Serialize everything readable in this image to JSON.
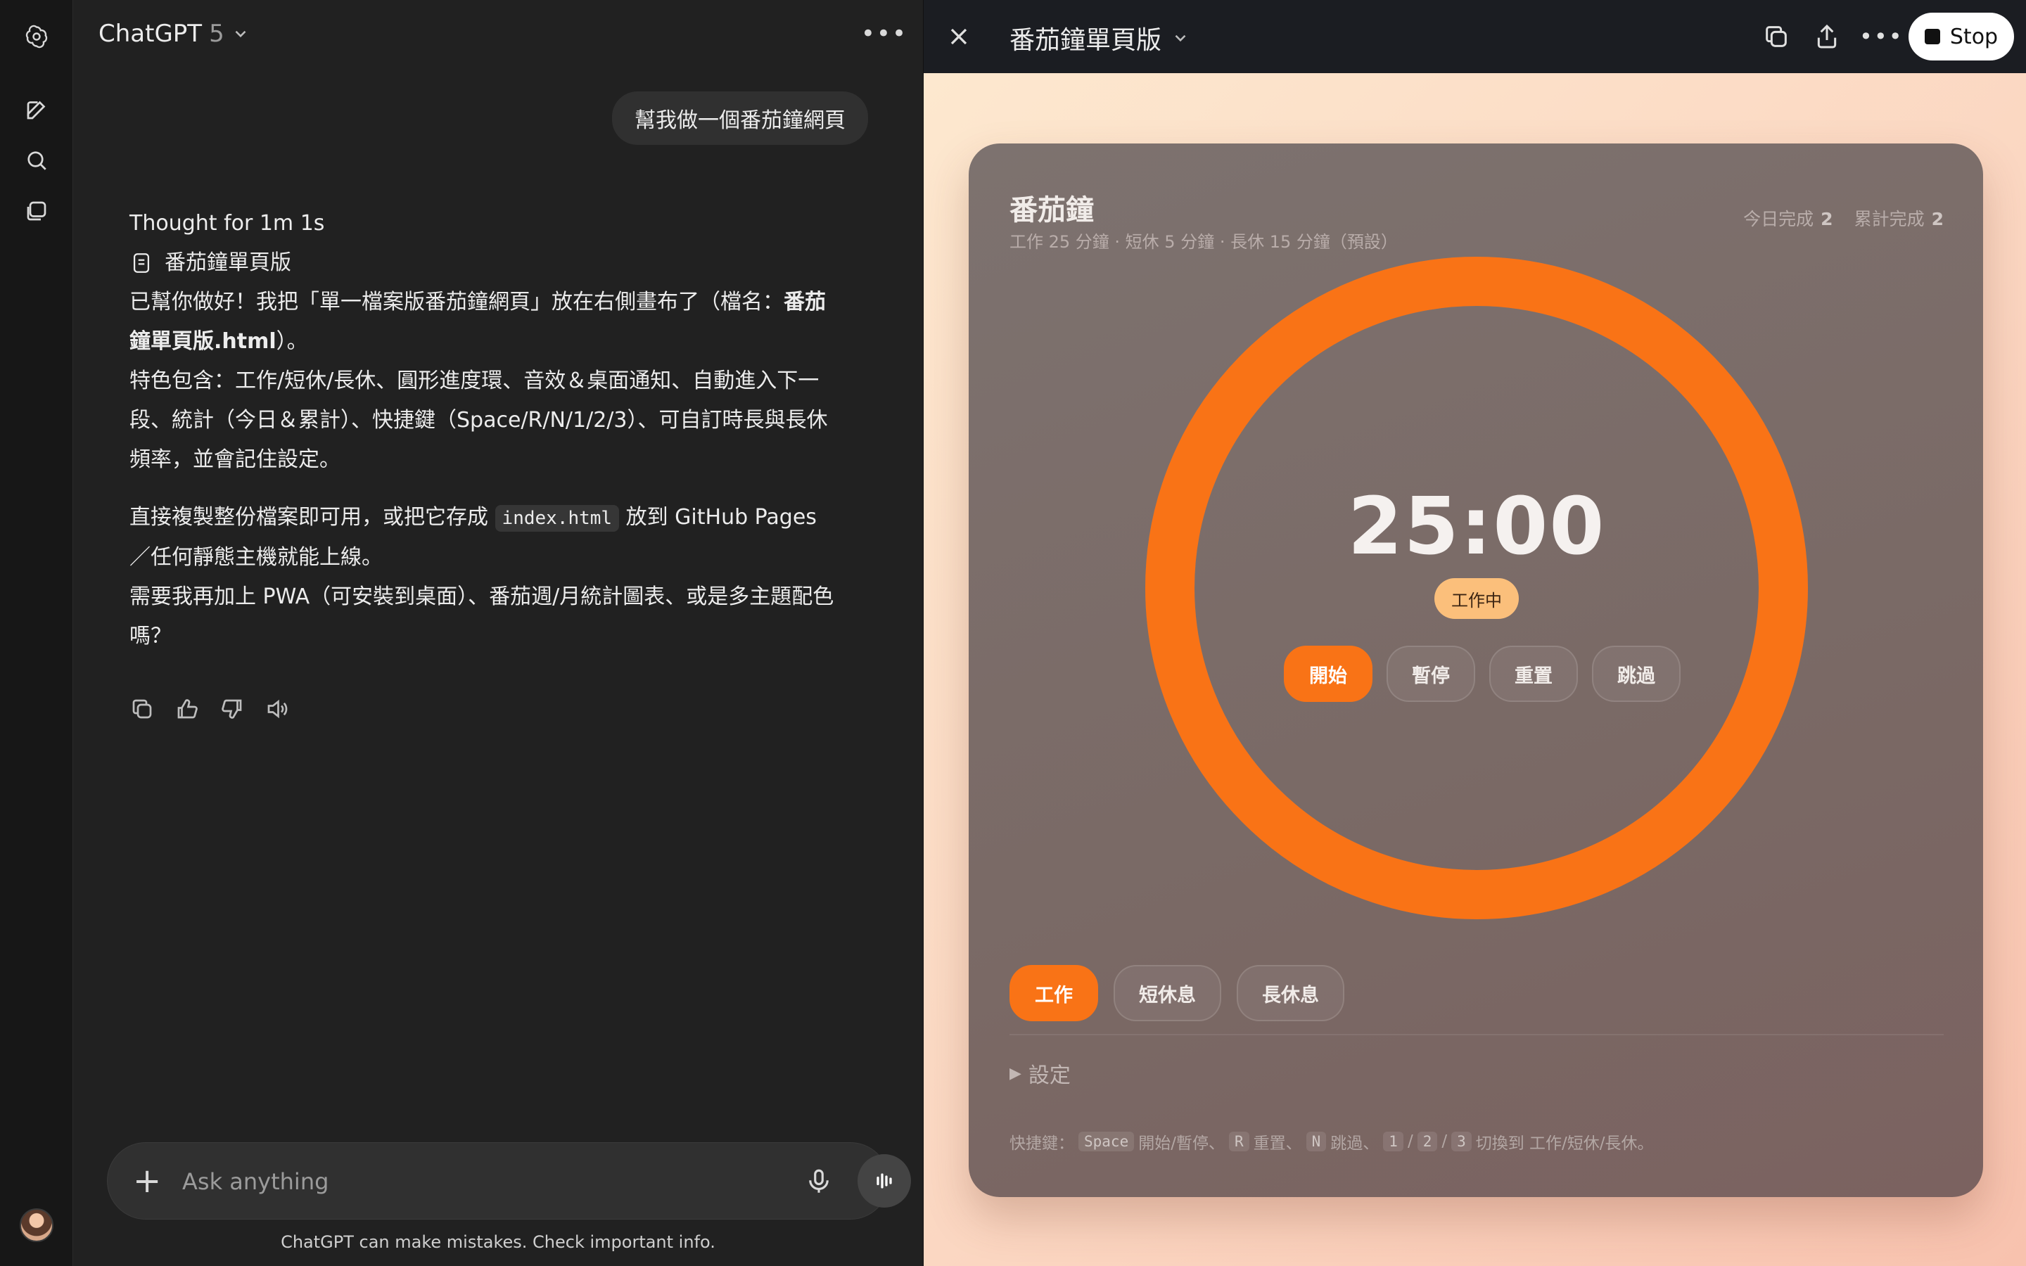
{
  "app": {
    "name": "ChatGPT",
    "version": "5"
  },
  "chat": {
    "user_message": "幫我做一個番茄鐘網頁",
    "thought": "Thought for 1m 1s",
    "file_name": "番茄鐘單頁版",
    "p1_a": "已幫你做好！我把「單一檔案版番茄鐘網頁」放在右側畫布了（檔名：",
    "p1_bold": "番茄鐘單頁版.html",
    "p1_b": "）。",
    "p2": "特色包含：工作/短休/長休、圓形進度環、音效＆桌面通知、自動進入下一段、統計（今日＆累計）、快捷鍵（Space/R/N/1/2/3）、可自訂時長與長休頻率，並會記住設定。",
    "p3_a": "直接複製整份檔案即可用，或把它存成 ",
    "p3_code": "index.html",
    "p3_b": " 放到 GitHub Pages ／任何靜態主機就能上線。",
    "p4": "需要我再加上 PWA（可安裝到桌面）、番茄週/月統計圖表、或是多主題配色嗎？",
    "composer_placeholder": "Ask anything",
    "disclaimer": "ChatGPT can make mistakes. Check important info."
  },
  "canvas": {
    "title": "番茄鐘單頁版",
    "stop_label": "Stop"
  },
  "timer": {
    "title": "番茄鐘",
    "subtitle": "工作 25 分鐘 · 短休 5 分鐘 · 長休 15 分鐘（預設）",
    "today_label": "今日完成",
    "today_value": "2",
    "total_label": "累計完成",
    "total_value": "2",
    "time": "25:00",
    "state": "工作中",
    "progress": 1.0,
    "controls": [
      "開始",
      "暫停",
      "重置",
      "跳過"
    ],
    "modes": [
      "工作",
      "短休息",
      "長休息"
    ],
    "settings_label": "設定",
    "hint_prefix": "快捷鍵：",
    "hint_k1": "Space",
    "hint_t1": "開始/暫停、",
    "hint_k2": "R",
    "hint_t2": "重置、",
    "hint_k3": "N",
    "hint_t3": "跳過、",
    "hint_k4": "1",
    "hint_sep1": "/",
    "hint_k5": "2",
    "hint_sep2": "/",
    "hint_k6": "3",
    "hint_t4": "切換到 工作/短休/長休。"
  },
  "colors": {
    "accent": "#f97316",
    "pill": "#fbbf7b"
  },
  "icons": [
    "openai-logo-icon",
    "new-chat-icon",
    "search-icon",
    "library-icon",
    "chevron-down-icon",
    "more-icon",
    "close-icon",
    "copy-icon",
    "share-icon",
    "thumbs-up-icon",
    "thumbs-down-icon",
    "read-aloud-icon",
    "plus-icon",
    "mic-icon",
    "voice-mode-icon",
    "document-icon"
  ]
}
